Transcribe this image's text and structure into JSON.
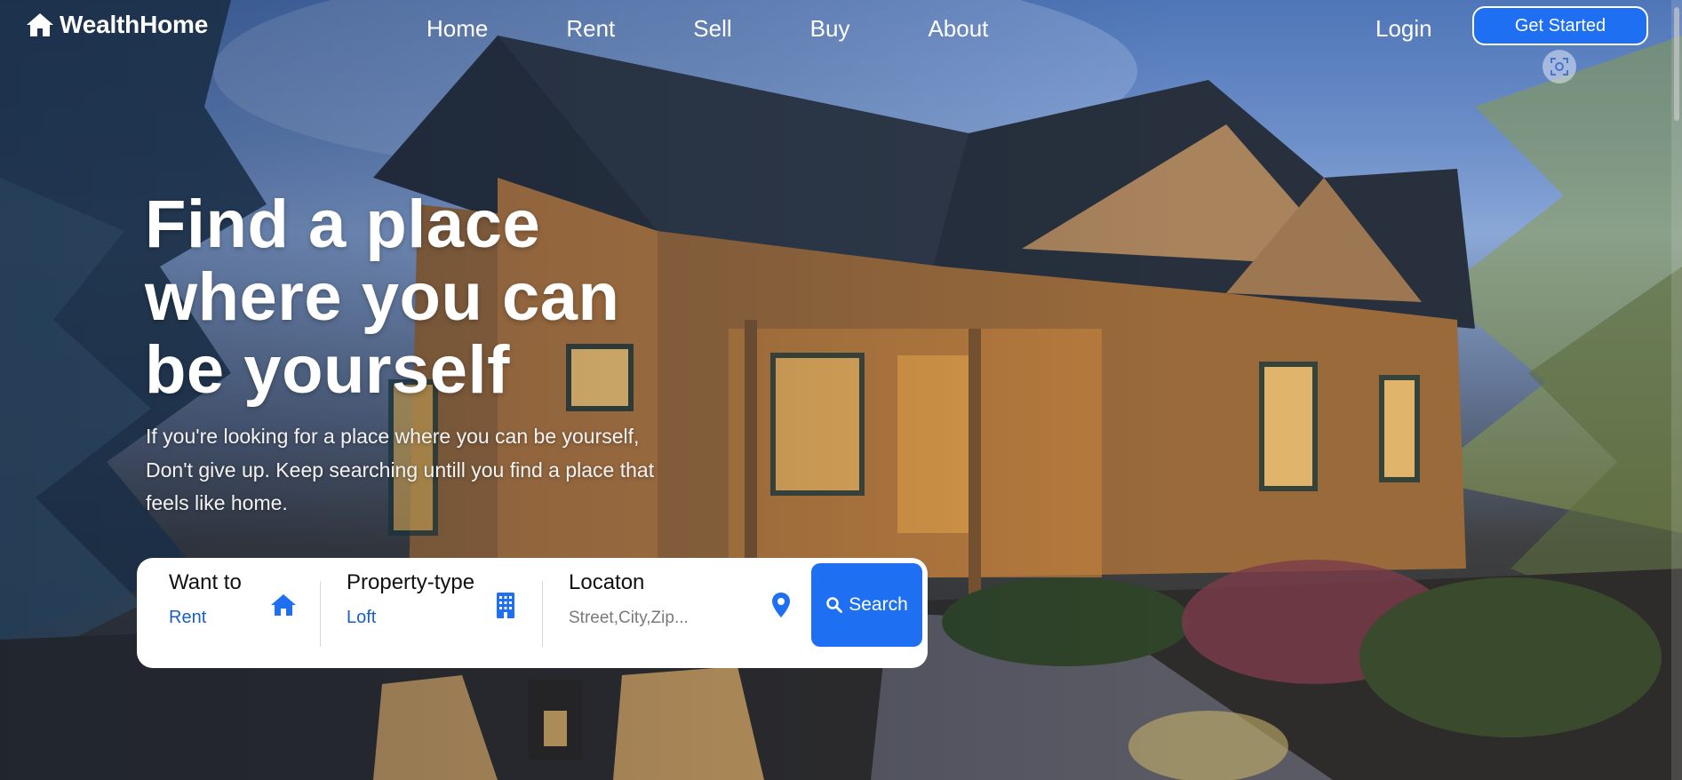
{
  "brand": {
    "name": "WealthHome",
    "icon": "home-icon"
  },
  "nav": {
    "links": [
      "Home",
      "Rent",
      "Sell",
      "Buy",
      "About"
    ],
    "login_label": "Login",
    "cta_label": "Get Started"
  },
  "hero": {
    "headline_lines": [
      "Find a place",
      "where you can",
      "be yourself"
    ],
    "subtext_lines": [
      "If you're looking for a place where you can be yourself,",
      "Don't give up. Keep searching untill you find a place that",
      "feels like home."
    ]
  },
  "search": {
    "want_to": {
      "label": "Want to",
      "value": "Rent",
      "icon": "home-icon"
    },
    "property_type": {
      "label": "Property-type",
      "value": "Loft",
      "icon": "building-icon"
    },
    "location": {
      "label": "Locaton",
      "placeholder": "Street,City,Zip...",
      "icon": "map-pin-icon"
    },
    "button_label": "Search",
    "button_icon": "search-icon"
  },
  "colors": {
    "accent": "#1f6ff3",
    "value_text": "#1a5fc4",
    "card": "#ffffff"
  }
}
